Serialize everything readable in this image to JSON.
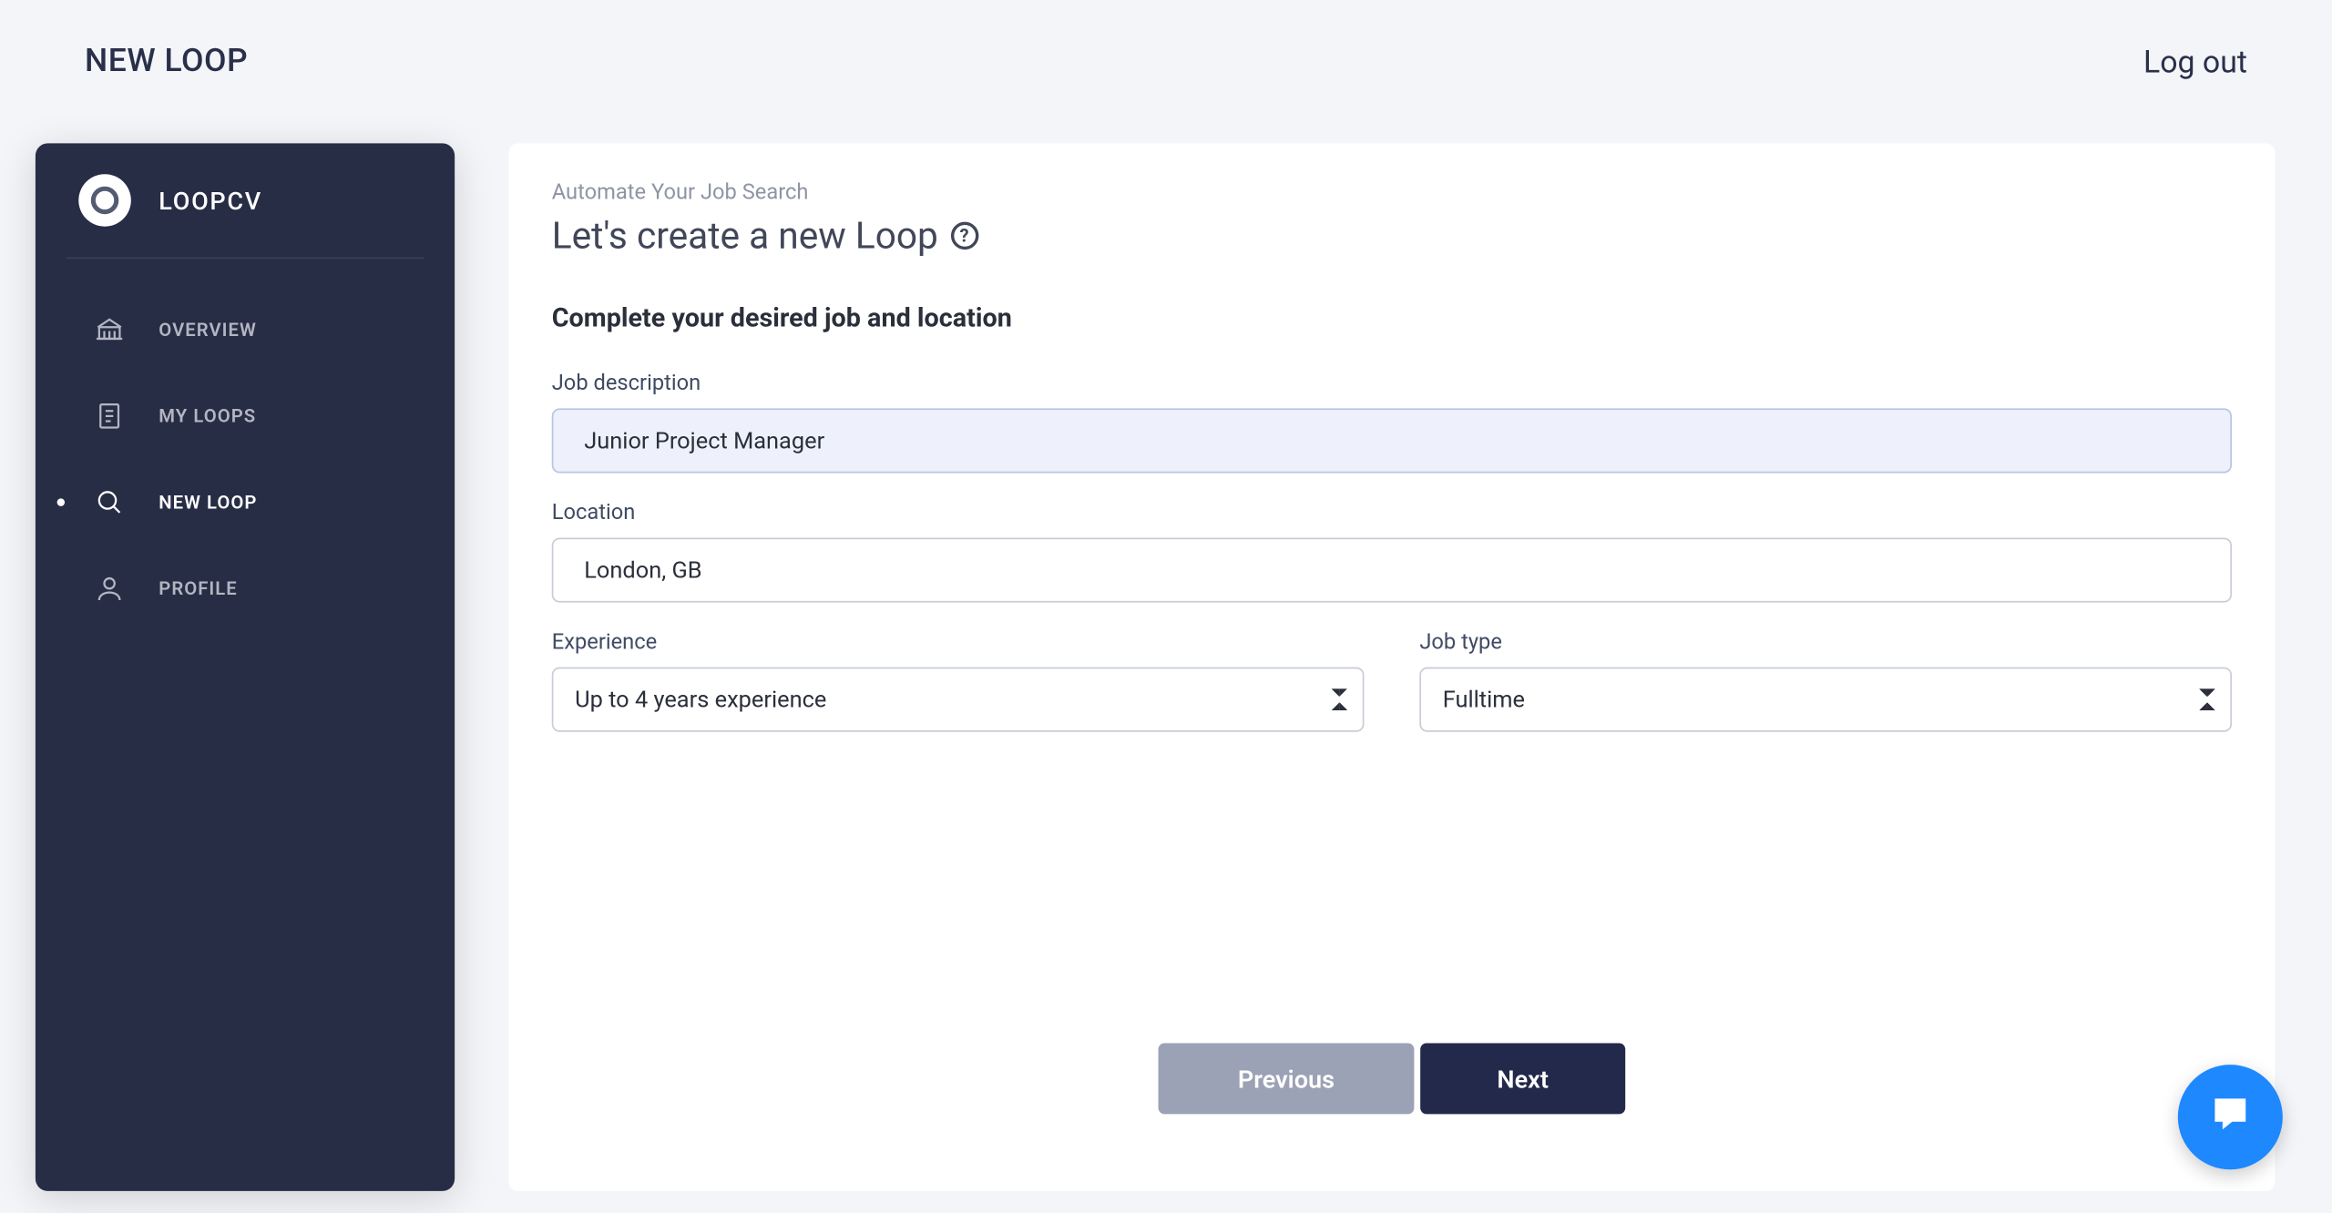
{
  "topbar": {
    "title": "NEW LOOP",
    "logout": "Log out"
  },
  "sidebar": {
    "brand": "LOOPCV",
    "items": [
      {
        "label": "OVERVIEW",
        "icon": "bank-icon",
        "active": false
      },
      {
        "label": "MY LOOPS",
        "icon": "document-icon",
        "active": false
      },
      {
        "label": "NEW LOOP",
        "icon": "search-icon",
        "active": true
      },
      {
        "label": "PROFILE",
        "icon": "user-icon",
        "active": false
      }
    ]
  },
  "main": {
    "subtitle": "Automate Your Job Search",
    "title": "Let's create a new Loop",
    "heading": "Complete your desired job and location",
    "fields": {
      "job_description": {
        "label": "Job description",
        "value": "Junior Project Manager"
      },
      "location": {
        "label": "Location",
        "value": "London, GB"
      },
      "experience": {
        "label": "Experience",
        "value": "Up to 4 years experience"
      },
      "job_type": {
        "label": "Job type",
        "value": "Fulltime"
      }
    },
    "buttons": {
      "previous": "Previous",
      "next": "Next"
    }
  }
}
